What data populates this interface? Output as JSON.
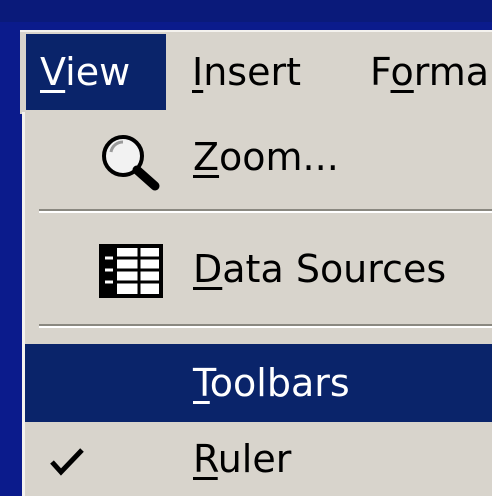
{
  "menubar": {
    "items": [
      {
        "label": "View",
        "mnemonic": "V",
        "rest": "iew",
        "selected": true
      },
      {
        "label": "Insert",
        "mnemonic": "I",
        "rest": "nsert",
        "selected": false
      },
      {
        "label": "Forma",
        "pre": "F",
        "mnemonic": "o",
        "rest": "rma",
        "selected": false
      }
    ]
  },
  "dropdown": {
    "items": [
      {
        "label": "Zoom...",
        "mnemonic": "Z",
        "rest": "oom...",
        "icon": "magnifier-icon"
      },
      {
        "label": "Data Sources",
        "mnemonic": "D",
        "rest": "ata Sources",
        "icon": "table-icon"
      },
      {
        "label": "Toolbars",
        "mnemonic": "T",
        "rest": "oolbars",
        "highlighted": true
      },
      {
        "label": "Ruler",
        "mnemonic": "R",
        "rest": "uler",
        "checked": true
      }
    ]
  },
  "colors": {
    "highlight": "#0a246a",
    "menu_bg": "#d8d4cc",
    "desktop": "#0b1b8c"
  }
}
